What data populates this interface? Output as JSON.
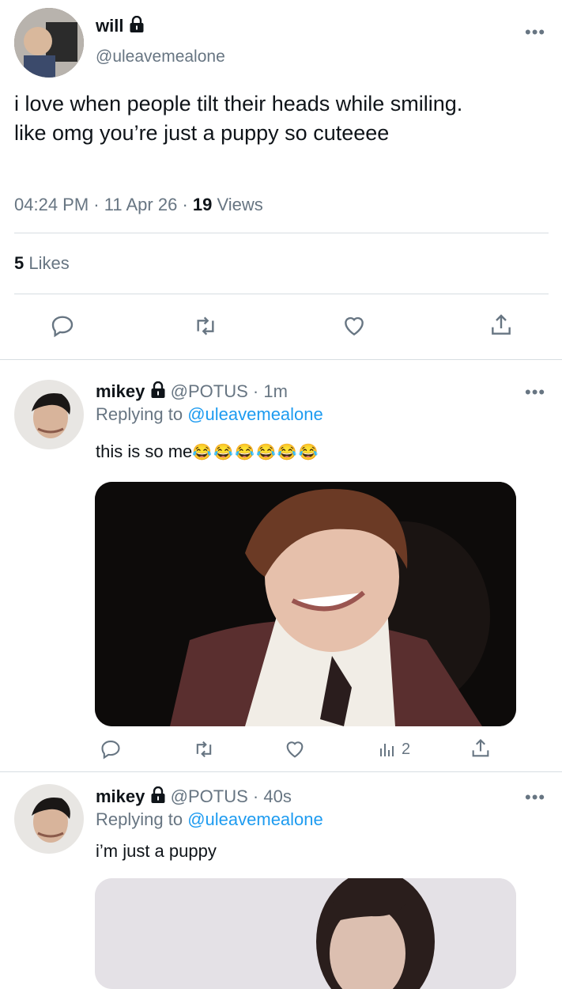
{
  "main_tweet": {
    "display_name": "will",
    "handle": "@uleavemealone",
    "text": "i love when people tilt their heads while smiling. like omg you’re just a puppy so cuteeee",
    "time": "04:24 PM",
    "sep1": "·",
    "date": "11 Apr 26",
    "sep2": "·",
    "views_count": "19",
    "views_label": "Views",
    "likes_count": "5",
    "likes_label": "Likes"
  },
  "replies": [
    {
      "display_name": "mikey",
      "handle": "@POTUS",
      "dot": "·",
      "time": "1m",
      "replying_prefix": "Replying to",
      "replying_handle": "@uleavemealone",
      "text": "this is so me",
      "emoji": "😂😂😂😂😂😂",
      "views": "2"
    },
    {
      "display_name": "mikey",
      "handle": "@POTUS",
      "dot": "·",
      "time": "40s",
      "replying_prefix": "Replying to",
      "replying_handle": "@uleavemealone",
      "text": "i’m just a puppy"
    }
  ],
  "icons": {
    "reply": "speech-bubble",
    "retweet": "retweet-arrows",
    "like": "heart-outline",
    "share": "share-upload",
    "views": "bar-chart",
    "more": "ellipsis",
    "lock": "padlock"
  },
  "colors": {
    "text": "#0f1419",
    "secondary": "#677582",
    "link": "#1d9bf0",
    "divider": "#d7dde2"
  }
}
